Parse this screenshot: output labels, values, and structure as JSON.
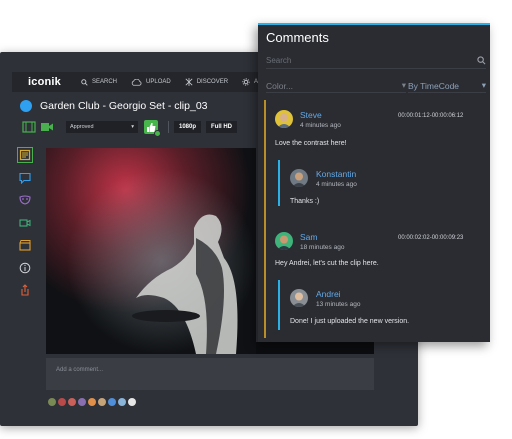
{
  "app": {
    "logo": "iconik",
    "nav": [
      {
        "label": "SEARCH",
        "icon": "search-icon"
      },
      {
        "label": "UPLOAD",
        "icon": "cloud-upload-icon"
      },
      {
        "label": "DISCOVER",
        "icon": "discover-icon"
      },
      {
        "label": "ADMIN",
        "icon": "gear-icon"
      }
    ],
    "title": "Garden Club - Georgio Set - clip_03",
    "status_value": "Approved",
    "resolution": "1080p",
    "zoom_mode": "Full HD",
    "left_tools": [
      "annotation-icon",
      "comment-icon",
      "masks-icon",
      "video-camera-icon",
      "clapper-icon",
      "info-icon",
      "share-icon"
    ],
    "comment_placeholder": "Add a comment...",
    "swatch_colors": [
      "#7a8a55",
      "#b84a4a",
      "#c9605a",
      "#8a6fb0",
      "#e0904a",
      "#c6a47a",
      "#4f8fd9",
      "#8ab4d8",
      "#e6e6e6"
    ]
  },
  "panel": {
    "title": "Comments",
    "search_placeholder": "Search",
    "color_filter": "Color...",
    "sort_filter": "By TimeCode",
    "accent": "#2bb1e6",
    "comments": [
      {
        "name": "Steve",
        "time": "4 minutes ago",
        "timecode": "00:00:01:12-00:00:06:12",
        "text": "Love the contrast here!"
      },
      {
        "name": "Konstantin",
        "time": "4 minutes ago",
        "timecode": "",
        "text": "Thanks :)"
      },
      {
        "name": "Sam",
        "time": "18 minutes ago",
        "timecode": "00:00:02:02-00:00:09:23",
        "text": "Hey Andrei, let's cut the clip here."
      },
      {
        "name": "Andrei",
        "time": "13 minutes ago",
        "timecode": "",
        "text": "Done! I just uploaded the new version."
      }
    ]
  }
}
